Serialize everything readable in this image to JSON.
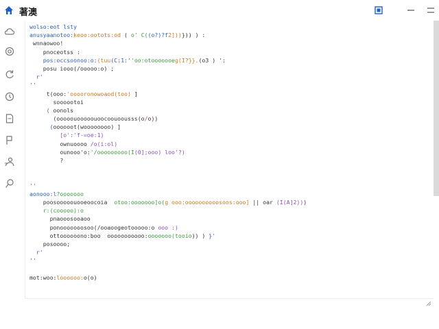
{
  "app": {
    "title": "著澳"
  },
  "window_controls": {
    "mode_icon": "panel-icon",
    "minimize_icon": "minimize-icon",
    "close_icon": "close-icon"
  },
  "sidebar": {
    "icons": [
      "cloud-icon",
      "target-icon",
      "refresh-icon",
      "history-icon",
      "document-icon",
      "flag-icon",
      "user-icon",
      "pin-icon"
    ]
  },
  "colors": {
    "accent": "#2b5fbf",
    "orange": "#c9781c",
    "green": "#3a9a3a",
    "purple": "#8a4fbf",
    "red": "#c43a3a",
    "scrollbar": "#dadada"
  },
  "code": {
    "lines": [
      [
        [
          "wolso:eot lsty",
          "t-blue"
        ]
      ],
      [
        [
          "anusyaanotoo:",
          "t-blue"
        ],
        [
          "keoo:ootots:od",
          "t-orange"
        ],
        [
          " ( ",
          "t-gray"
        ],
        [
          "o' C(",
          "t-green"
        ],
        [
          "(o?)?f",
          "t-blue"
        ],
        [
          "2]))",
          "t-orange"
        ],
        [
          "})) ) :",
          "t-gray"
        ]
      ],
      [
        [
          " wnnaowoo!",
          "t-gray"
        ]
      ],
      [
        [
          "    pnoceotss :",
          "t-gray"
        ]
      ],
      [
        [
          "    pos:occsoonoo:o:",
          "t-blue"
        ],
        [
          "(tuu",
          "t-orange"
        ],
        [
          "(C:1:'",
          "t-blue"
        ],
        [
          "'oo:otooooooe",
          "t-green"
        ],
        [
          "g(I?}}.",
          "t-orange"
        ],
        [
          "(o3 ) ':",
          "t-gray"
        ]
      ],
      [
        [
          "    posu iooo(/ooooo:o) ;",
          "t-gray"
        ]
      ],
      [
        [
          "  ",
          "t-gray"
        ],
        [
          "r'",
          "t-blue"
        ]
      ],
      [
        [
          "''",
          "t-blue"
        ]
      ],
      [
        [
          "     t(ooo:",
          "t-gray"
        ],
        [
          "'ooooronowoaod(too)",
          "t-orange"
        ],
        [
          " ]",
          "t-gray"
        ]
      ],
      [
        [
          "       soooootoi",
          "t-gray"
        ]
      ],
      [
        [
          "     ",
          "t-gray"
        ],
        [
          "(",
          "t-blue"
        ],
        [
          " oonols",
          "t-gray"
        ]
      ],
      [
        [
          "       (ooooouooooouoocoouoousss(o",
          "t-gray"
        ],
        [
          "/",
          "t-red"
        ],
        [
          "o))",
          "t-gray"
        ]
      ],
      [
        [
          "      ",
          "t-gray"
        ],
        [
          "(",
          "t-blue"
        ],
        [
          "oooooot(woooooooo)",
          "t-gray"
        ],
        [
          " ]",
          "t-gray"
        ]
      ],
      [
        [
          "         [o':'f-=oe:1)",
          "t-purple"
        ]
      ],
      [
        [
          "         ownuoooo ",
          "t-gray"
        ],
        [
          "/o(i:ol)",
          "t-purple"
        ]
      ],
      [
        [
          "         ounooo'o:",
          "t-gray"
        ],
        [
          "'/ooooooooo(I",
          "t-green"
        ],
        [
          "(0];ooo) loo'?)",
          "t-purple"
        ]
      ],
      [
        [
          "         ?",
          "t-gray"
        ]
      ],
      [
        [
          "",
          "t-gray"
        ]
      ],
      [
        [
          "",
          "t-gray"
        ]
      ],
      [
        [
          "''",
          "t-blue"
        ]
      ],
      [
        [
          "aonooo:l",
          "t-blue"
        ],
        [
          "?ooooooo",
          "t-green"
        ]
      ],
      [
        [
          "    poosooooouooeoocoia  ",
          "t-gray"
        ],
        [
          "otoo:ooooooo]o(",
          "t-green"
        ],
        [
          "g ooo:oooooooooosoos:ooo]",
          "t-orange"
        ],
        [
          " || oar ",
          "t-gray"
        ],
        [
          "(I(A]2))",
          "t-purple"
        ],
        [
          ")",
          "t-gray"
        ]
      ],
      [
        [
          "    ",
          "t-gray"
        ],
        [
          "r:(cooooo):o",
          "t-green"
        ]
      ],
      [
        [
          "      pnaooosooaoo",
          "t-gray"
        ]
      ],
      [
        [
          "      ponooooooosoo(/ooaoogeotooooo:o ",
          "t-gray"
        ],
        [
          "ooo :)",
          "t-purple"
        ]
      ],
      [
        [
          "      ottoooooono:boo  ooooooooooo:",
          "t-gray"
        ],
        [
          "ooooooo(tooio",
          "t-green"
        ],
        [
          ")) ) ",
          "t-gray"
        ],
        [
          "}'",
          "t-blue"
        ]
      ],
      [
        [
          "    posoooo;",
          "t-gray"
        ]
      ],
      [
        [
          "  ",
          "t-gray"
        ],
        [
          "r'",
          "t-blue"
        ]
      ],
      [
        [
          "''",
          "t-blue"
        ]
      ],
      [
        [
          "",
          "t-gray"
        ]
      ],
      [
        [
          "mot:woo:",
          "t-gray"
        ],
        [
          "loooooo:",
          "t-orange"
        ],
        [
          "o(o)",
          "t-gray"
        ]
      ]
    ]
  }
}
